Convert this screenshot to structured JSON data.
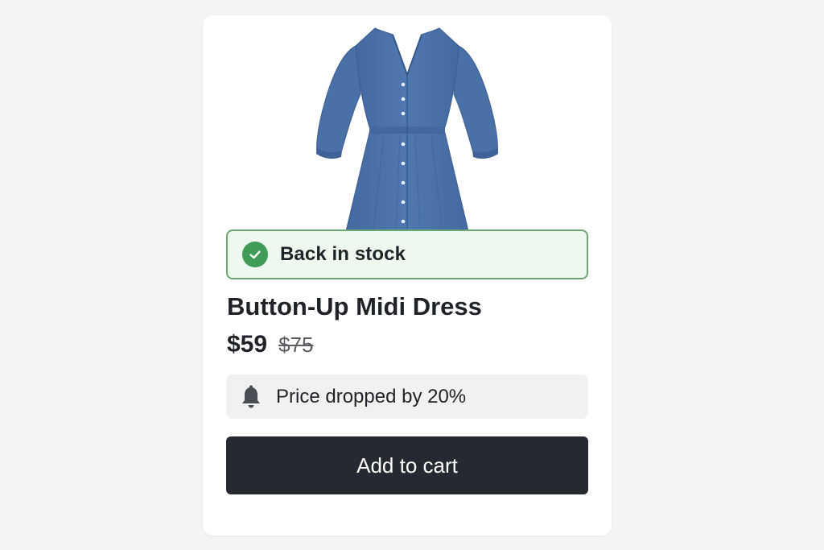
{
  "product": {
    "image_alt": "blue button-up midi dress",
    "stock_status": "Back in stock",
    "title": "Button-Up Midi Dress",
    "price_current": "$59",
    "price_original": "$75",
    "alert_text": "Price dropped by 20%",
    "add_to_cart_label": "Add to cart",
    "price_drop_percent": 20
  },
  "icons": {
    "stock": "check-circle-icon",
    "alert": "bell-icon"
  },
  "colors": {
    "background": "#f4f4f4",
    "card": "#ffffff",
    "stock_bg": "#edf9ef",
    "stock_border": "#6aa972",
    "check": "#3f9b55",
    "alert_bg": "#f1f1f1",
    "button_bg": "#262a30",
    "button_text": "#ffffff",
    "dress": "#4c73aa"
  }
}
